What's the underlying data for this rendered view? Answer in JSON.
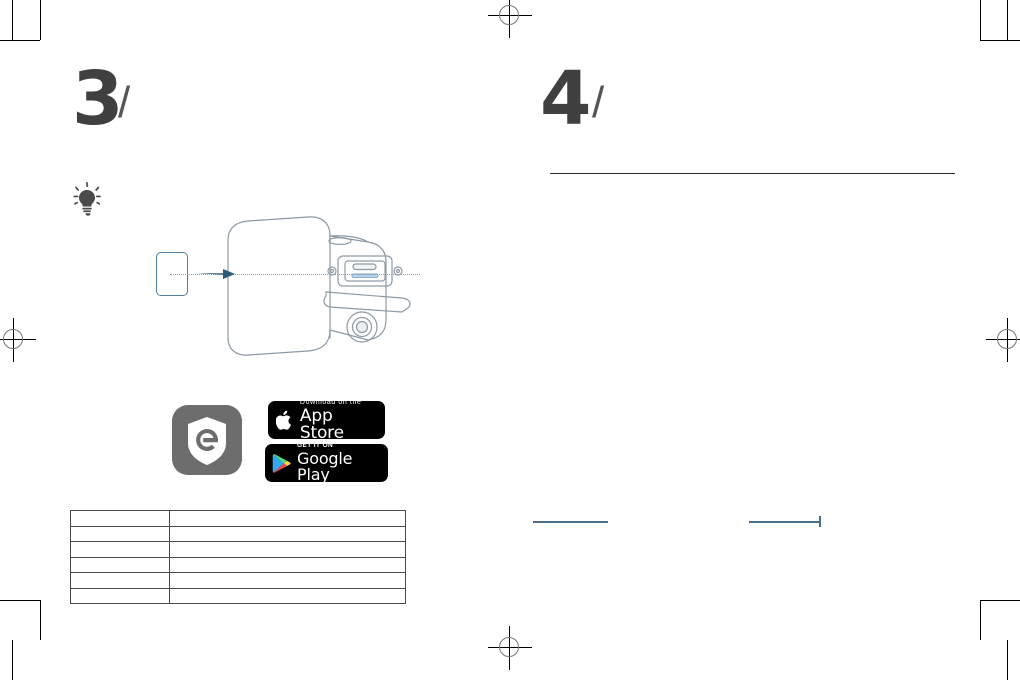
{
  "document": {
    "type": "printed-instruction-manual-spread",
    "background_color": "#ffffff"
  },
  "print_marks": {
    "registration_icon": "registration-crosshair",
    "crop_icon": "crop-mark",
    "fold_icon": "fold-line"
  },
  "panels": {
    "left": {
      "step_number": "3",
      "step_separator": "/",
      "tip_icon": "lightbulb-icon",
      "illustration": {
        "name": "camera-sd-card-insertion-diagram",
        "card_icon": "microsd-card",
        "arrow_icon": "arrow-right-icon",
        "guide_icon": "dotted-guide-line",
        "camera_icon": "security-camera",
        "port_icon": "usb-c-port",
        "slot_icon": "microsd-slot",
        "screw_icon": "screw-head"
      },
      "app": {
        "icon_name": "app-shield-icon",
        "icon_background": "#6d6d6d",
        "badges": [
          {
            "name": "app-store-badge",
            "icon": "apple-logo-icon",
            "small_text": "Download on the",
            "large_text": "App Store",
            "background": "#000000"
          },
          {
            "name": "google-play-badge",
            "icon": "google-play-triangle-icon",
            "small_text": "GET IT ON",
            "large_text": "Google Play",
            "background": "#000000"
          }
        ]
      },
      "spec_table": {
        "name": "specification-table",
        "columns": 2,
        "rows": [
          [
            "",
            ""
          ],
          [
            "",
            ""
          ],
          [
            "",
            ""
          ],
          [
            "",
            ""
          ],
          [
            "",
            ""
          ],
          [
            "",
            ""
          ]
        ]
      }
    },
    "right": {
      "step_number": "4",
      "step_separator": "/",
      "divider": true,
      "illustration": {
        "name": "camera-detection-range-diagram",
        "house_icon": "two-story-house",
        "camera_icon": "wall-mounted-camera",
        "person_icon": "walking-person-silhouette",
        "upper_cone_color": "#d4d4d4",
        "lower_cone_color": "#b0b0b0",
        "house_trim_color": "#4a4a4a",
        "dimension_line_color": "#4b6f86",
        "dimension_lines": [
          {
            "name": "mounting-height-dimension",
            "orientation": "vertical",
            "label": ""
          },
          {
            "name": "detection-drop-dimension",
            "orientation": "vertical",
            "label": ""
          },
          {
            "name": "far-range-dimension",
            "orientation": "horizontal",
            "label": ""
          },
          {
            "name": "near-range-dimension",
            "orientation": "horizontal",
            "label": ""
          }
        ]
      }
    }
  }
}
